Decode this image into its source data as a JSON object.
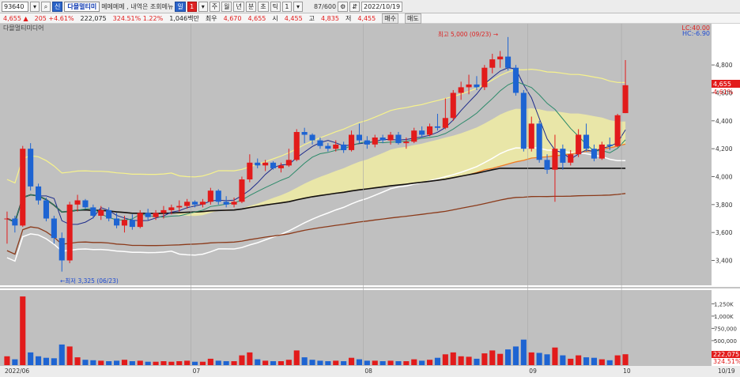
{
  "toolbar": {
    "code": "93640",
    "market_badge": "신",
    "name": "다믈멀티미",
    "memo_text": "메메메메 , 내역은 조회메뉴 ",
    "period_buttons": [
      "일",
      "1",
      "주",
      "월",
      "년",
      "분",
      "초",
      "틱"
    ],
    "count_text": "87/600",
    "date": "2022/10/19"
  },
  "infobar": {
    "price": "4,655 ▲",
    "change": "205 +4.61%",
    "volume": "222,075",
    "volume_change": "324.51% 1.22%",
    "amount": "1,046백만",
    "best_label": "최우",
    "best_value": "4,670",
    "best_value2": "4,655",
    "open_label": "시",
    "open_value": "4,455",
    "high_label": "고",
    "high_value": "4,835",
    "low_label": "저",
    "low_value": "4,455",
    "sell_btn": "매수",
    "buy_btn": "매도"
  },
  "chart": {
    "series_label": "다믈멀티미디어",
    "lc_label": "LC:40.00",
    "hc_label": "HC:-6.90",
    "high_annotation": "최고 5,000 (09/23) →",
    "low_annotation": "←최저 3,325 (06/23)",
    "current_price_tag": "4,655",
    "current_pct_tag": "4.61%",
    "volume_tag": "222,075",
    "volume_pct_tag": "324.51%",
    "price_axis": [
      "4,800",
      "4,600",
      "4,400",
      "4,200",
      "4,000",
      "3,800",
      "3,600",
      "3,400"
    ],
    "volume_axis": [
      "1,250K",
      "1,000K",
      "750,000",
      "500,000"
    ],
    "x_axis": [
      "2022/06",
      "07",
      "08",
      "09",
      "10",
      "10/19"
    ]
  },
  "colors": {
    "up": "#e21b1b",
    "down": "#1e64d2",
    "bg": "#c0c0c0"
  },
  "chart_data": {
    "type": "candlestick",
    "ylim": [
      3250,
      5050
    ],
    "volume_ylim": [
      0,
      1450
    ],
    "candles": [
      [
        3700,
        3750,
        3520,
        3700,
        180
      ],
      [
        3700,
        3720,
        3600,
        3650,
        120
      ],
      [
        3650,
        4220,
        3640,
        4200,
        1400
      ],
      [
        4200,
        4240,
        3900,
        3930,
        260
      ],
      [
        3930,
        3950,
        3800,
        3830,
        180
      ],
      [
        3830,
        3850,
        3680,
        3700,
        150
      ],
      [
        3700,
        3720,
        3520,
        3560,
        140
      ],
      [
        3560,
        3600,
        3320,
        3400,
        420
      ],
      [
        3400,
        3820,
        3380,
        3800,
        380
      ],
      [
        3800,
        3870,
        3750,
        3830,
        160
      ],
      [
        3830,
        3840,
        3770,
        3780,
        110
      ],
      [
        3780,
        3800,
        3700,
        3720,
        100
      ],
      [
        3720,
        3790,
        3690,
        3760,
        90
      ],
      [
        3760,
        3780,
        3680,
        3700,
        80
      ],
      [
        3700,
        3740,
        3630,
        3650,
        90
      ],
      [
        3650,
        3720,
        3600,
        3690,
        110
      ],
      [
        3690,
        3730,
        3620,
        3640,
        80
      ],
      [
        3640,
        3760,
        3630,
        3740,
        90
      ],
      [
        3740,
        3770,
        3690,
        3710,
        70
      ],
      [
        3710,
        3760,
        3690,
        3740,
        70
      ],
      [
        3740,
        3790,
        3700,
        3760,
        80
      ],
      [
        3760,
        3800,
        3730,
        3780,
        70
      ],
      [
        3780,
        3830,
        3750,
        3790,
        80
      ],
      [
        3790,
        3840,
        3770,
        3820,
        90
      ],
      [
        3820,
        3830,
        3780,
        3800,
        70
      ],
      [
        3800,
        3840,
        3780,
        3820,
        70
      ],
      [
        3820,
        3920,
        3800,
        3900,
        130
      ],
      [
        3900,
        3910,
        3800,
        3820,
        90
      ],
      [
        3820,
        3860,
        3780,
        3800,
        80
      ],
      [
        3800,
        3850,
        3780,
        3820,
        80
      ],
      [
        3820,
        4000,
        3810,
        3980,
        200
      ],
      [
        3980,
        4160,
        3960,
        4100,
        260
      ],
      [
        4100,
        4130,
        4060,
        4080,
        120
      ],
      [
        4080,
        4120,
        4040,
        4100,
        90
      ],
      [
        4100,
        4110,
        4050,
        4060,
        80
      ],
      [
        4060,
        4100,
        4030,
        4080,
        80
      ],
      [
        4080,
        4200,
        4070,
        4120,
        110
      ],
      [
        4120,
        4340,
        4110,
        4320,
        300
      ],
      [
        4320,
        4350,
        4240,
        4300,
        160
      ],
      [
        4300,
        4310,
        4230,
        4260,
        110
      ],
      [
        4260,
        4280,
        4200,
        4220,
        90
      ],
      [
        4220,
        4240,
        4180,
        4200,
        80
      ],
      [
        4200,
        4260,
        4180,
        4230,
        90
      ],
      [
        4230,
        4250,
        4170,
        4190,
        80
      ],
      [
        4190,
        4330,
        4180,
        4300,
        150
      ],
      [
        4300,
        4380,
        4240,
        4260,
        120
      ],
      [
        4260,
        4290,
        4200,
        4230,
        90
      ],
      [
        4230,
        4300,
        4210,
        4280,
        90
      ],
      [
        4280,
        4300,
        4240,
        4260,
        80
      ],
      [
        4260,
        4320,
        4230,
        4300,
        90
      ],
      [
        4300,
        4320,
        4230,
        4240,
        80
      ],
      [
        4240,
        4280,
        4200,
        4250,
        80
      ],
      [
        4250,
        4350,
        4240,
        4330,
        120
      ],
      [
        4330,
        4360,
        4280,
        4300,
        90
      ],
      [
        4300,
        4380,
        4290,
        4360,
        110
      ],
      [
        4360,
        4450,
        4330,
        4350,
        150
      ],
      [
        4350,
        4560,
        4340,
        4420,
        220
      ],
      [
        4420,
        4620,
        4400,
        4600,
        260
      ],
      [
        4600,
        4680,
        4550,
        4640,
        180
      ],
      [
        4640,
        4730,
        4590,
        4660,
        170
      ],
      [
        4660,
        4720,
        4620,
        4640,
        130
      ],
      [
        4640,
        4800,
        4620,
        4780,
        240
      ],
      [
        4780,
        4880,
        4740,
        4840,
        300
      ],
      [
        4840,
        4900,
        4780,
        4860,
        230
      ],
      [
        4860,
        5000,
        4760,
        4780,
        320
      ],
      [
        4780,
        4800,
        4580,
        4600,
        380
      ],
      [
        4600,
        4620,
        4180,
        4200,
        520
      ],
      [
        4200,
        4430,
        4180,
        4380,
        260
      ],
      [
        4380,
        4400,
        4100,
        4120,
        250
      ],
      [
        4120,
        4160,
        4020,
        4050,
        220
      ],
      [
        4050,
        4300,
        3820,
        4200,
        360
      ],
      [
        4200,
        4230,
        4050,
        4100,
        200
      ],
      [
        4100,
        4190,
        4080,
        4160,
        130
      ],
      [
        4160,
        4340,
        4140,
        4300,
        200
      ],
      [
        4300,
        4380,
        4180,
        4200,
        160
      ],
      [
        4200,
        4230,
        4110,
        4130,
        150
      ],
      [
        4130,
        4250,
        4120,
        4230,
        120
      ],
      [
        4230,
        4280,
        4190,
        4220,
        100
      ],
      [
        4220,
        4450,
        4210,
        4440,
        200
      ],
      [
        4455,
        4835,
        4455,
        4655,
        222
      ]
    ]
  }
}
